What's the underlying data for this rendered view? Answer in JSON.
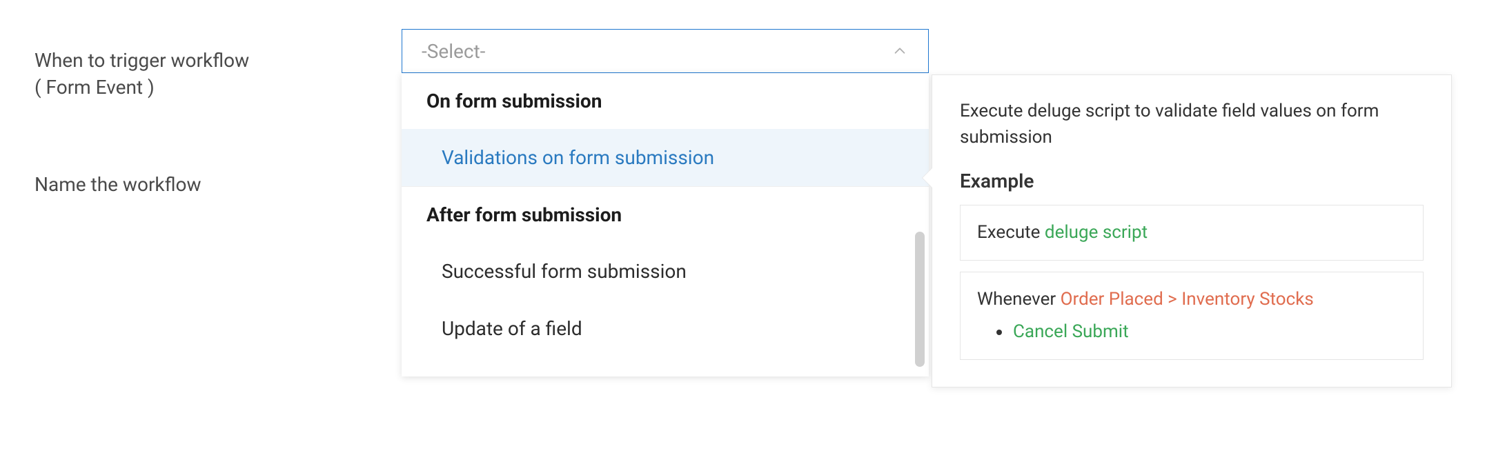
{
  "labels": {
    "trigger_line1": "When to trigger workflow",
    "trigger_line2": "( Form Event )",
    "name_workflow": "Name the workflow"
  },
  "select": {
    "placeholder": "-Select-"
  },
  "dropdown": {
    "group1": "On form submission",
    "option1": "Validations on form submission",
    "group2": "After form submission",
    "option2": "Successful form submission",
    "option3": "Update of a field"
  },
  "help": {
    "description": "Execute deluge script to validate field values on form submission",
    "example_label": "Example",
    "box1_prefix": "Execute ",
    "box1_green": "deluge script",
    "box2_prefix": "Whenever ",
    "box2_orange": "Order Placed > Inventory Stocks",
    "box2_bullet": "Cancel Submit"
  }
}
